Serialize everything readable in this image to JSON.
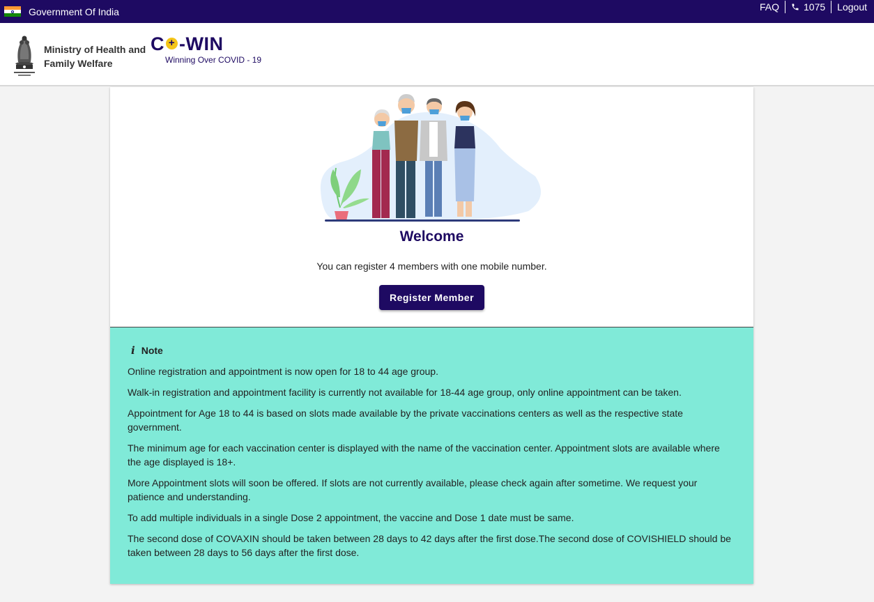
{
  "topbar": {
    "govt_label": "Government Of India",
    "faq_label": "FAQ",
    "helpline": "1075",
    "logout_label": "Logout"
  },
  "header": {
    "ministry_line1": "Ministry of Health and",
    "ministry_line2": "Family Welfare",
    "logo_c": "C",
    "logo_rest": "-WIN",
    "tagline": "Winning Over COVID - 19"
  },
  "main": {
    "welcome": "Welcome",
    "register_text": "You can register 4 members with one mobile number.",
    "register_button": "Register Member"
  },
  "note": {
    "title": "Note",
    "items": [
      "Online registration and appointment is now open for 18 to 44 age group.",
      "Walk-in registration and appointment facility is currently not available for 18-44 age group, only online appointment can be taken.",
      "Appointment for Age 18 to 44 is based on slots made available by the private vaccinations centers as well as the respective state government.",
      "The minimum age for each vaccination center is displayed with the name of the vaccination center. Appointment slots are available where the age displayed is 18+.",
      "More Appointment slots will soon be offered. If slots are not currently available, please check again after sometime. We request your patience and understanding.",
      "To add multiple individuals in a single Dose 2 appointment, the vaccine and Dose 1 date must be same.",
      "The second dose of COVAXIN should be taken between 28 days to 42 days after the first dose.The second dose of COVISHIELD should be taken between 28 days to 56 days after the first dose."
    ]
  },
  "icons": [
    "india-flag-icon",
    "phone-icon",
    "state-emblem-icon",
    "info-icon"
  ],
  "colors": {
    "primary": "#1e0a62",
    "note_bg": "#80ead8",
    "logo_accent": "#f5c518"
  }
}
